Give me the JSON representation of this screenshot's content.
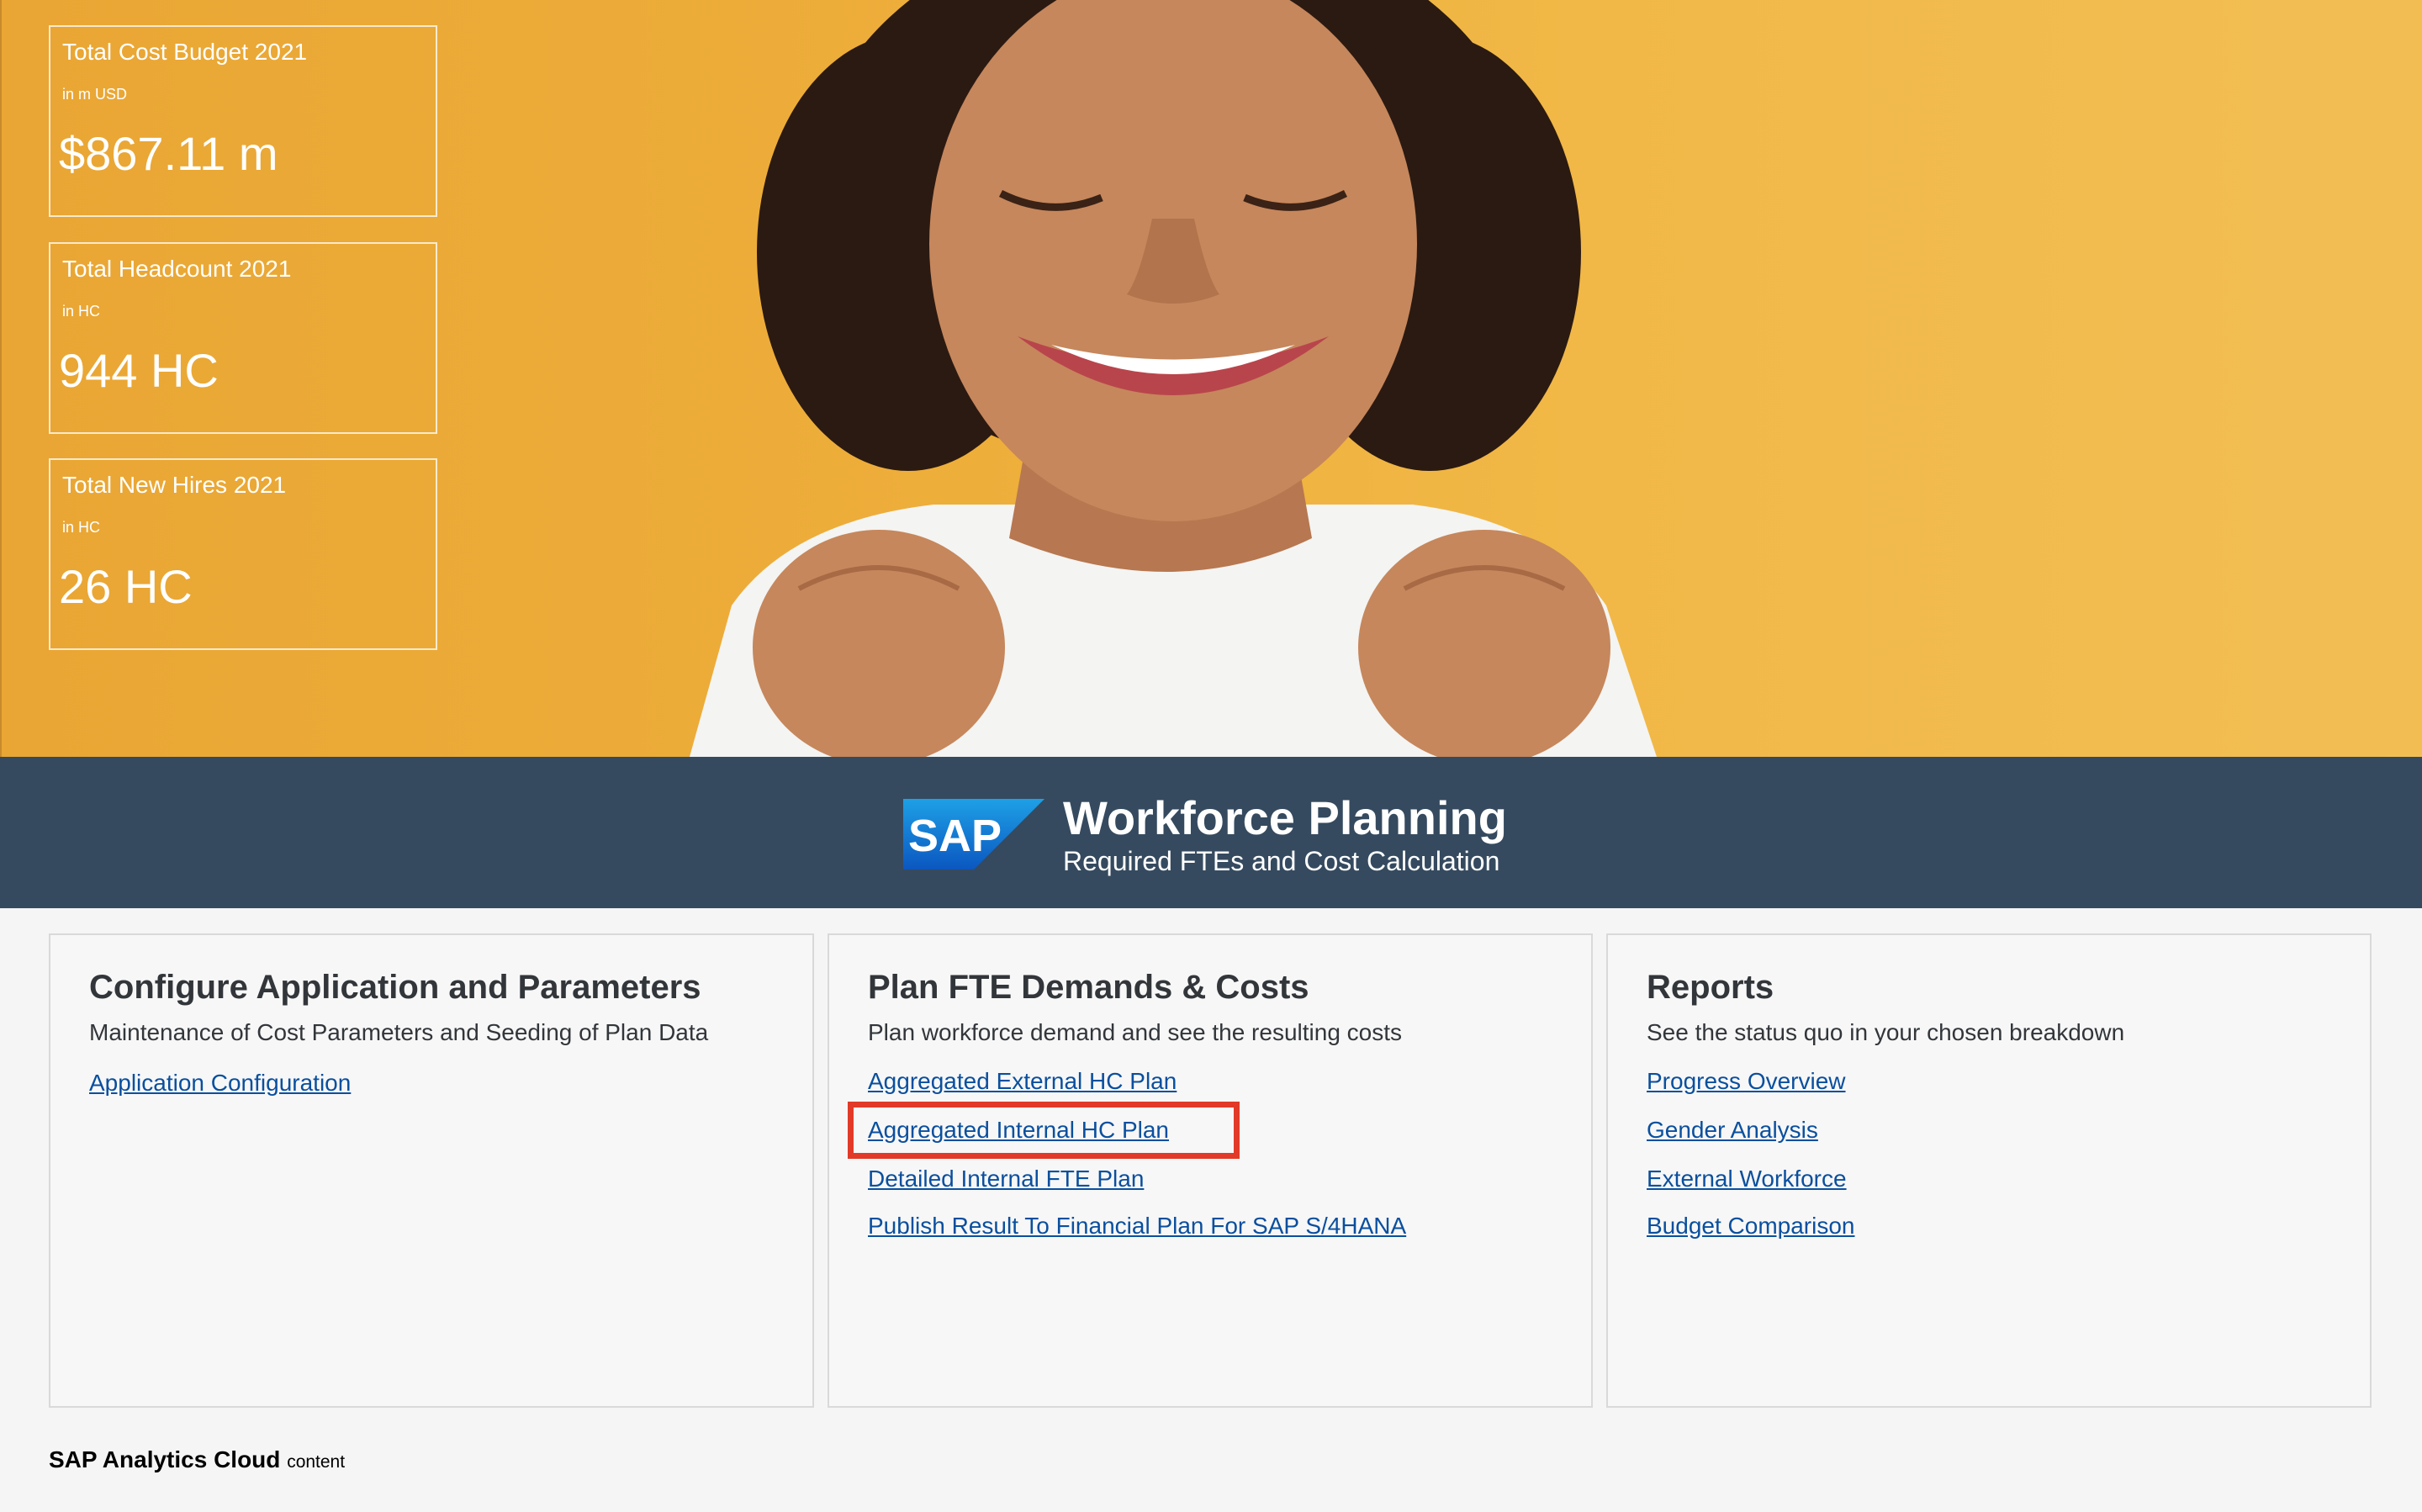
{
  "kpis": [
    {
      "title": "Total Cost Budget 2021",
      "unit": "in m USD",
      "value": "$867.11 m"
    },
    {
      "title": "Total Headcount 2021",
      "unit": "in HC",
      "value": "944 HC"
    },
    {
      "title": "Total New Hires 2021",
      "unit": "in HC",
      "value": "26 HC"
    }
  ],
  "banner": {
    "logo_text": "SAP",
    "title": "Workforce Planning",
    "subtitle": "Required FTEs and Cost Calculation"
  },
  "cards": [
    {
      "title": "Configure Application and Parameters",
      "description": "Maintenance of Cost Parameters and Seeding of Plan Data",
      "links": [
        "Application Configuration"
      ]
    },
    {
      "title": "Plan FTE Demands & Costs",
      "description": "Plan workforce demand and see the resulting costs",
      "links": [
        "Aggregated External HC Plan",
        "Aggregated Internal HC Plan",
        "Detailed Internal FTE Plan",
        "Publish Result To Financial Plan For SAP S/4HANA"
      ]
    },
    {
      "title": "Reports",
      "description": "See the status quo in your chosen breakdown",
      "links": [
        "Progress Overview",
        "Gender Analysis",
        "External Workforce",
        "Budget Comparison"
      ]
    }
  ],
  "footer": {
    "brand": "SAP Analytics Cloud",
    "suffix": "content"
  },
  "colors": {
    "hero_yellow": "#eeae3a",
    "banner_blue": "#354a5f",
    "link_blue": "#0a4f9e",
    "highlight_red": "#e23a28"
  }
}
